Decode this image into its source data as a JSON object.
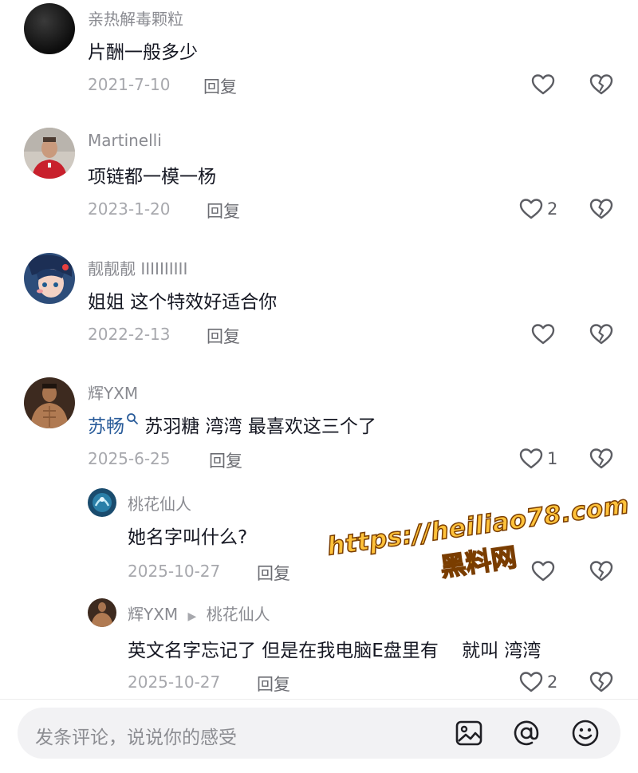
{
  "comments": [
    {
      "username": "亲热解毒颗粒",
      "text": "片酬一般多少",
      "date": "2021-7-10",
      "reply_label": "回复",
      "like_count": ""
    },
    {
      "username": "Martinelli",
      "text": "项链都一模一杨",
      "date": "2023-1-20",
      "reply_label": "回复",
      "like_count": "2"
    },
    {
      "username": "靓靓靓 IIIIIIIIII",
      "text": "姐姐 这个特效好适合你",
      "date": "2022-2-13",
      "reply_label": "回复",
      "like_count": ""
    },
    {
      "username": "辉YXM",
      "mention": "苏畅",
      "text": " 苏羽糖 湾湾 最喜欢这三个了",
      "date": "2025-6-25",
      "reply_label": "回复",
      "like_count": "1"
    }
  ],
  "replies": [
    {
      "username": "桃花仙人",
      "text": "她名字叫什么?",
      "date": "2025-10-27",
      "reply_label": "回复",
      "like_count": ""
    },
    {
      "username": "辉YXM",
      "reply_to": "桃花仙人",
      "text": "英文名字忘记了 但是在我电脑E盘里有    就叫 湾湾",
      "date": "2025-10-27",
      "reply_label": "回复",
      "like_count": "2"
    }
  ],
  "input": {
    "placeholder": "发条评论，说说你的感受",
    "icons": [
      "image-icon",
      "at-icon",
      "emoji-icon"
    ]
  },
  "watermark": {
    "url": "https://heiliao78.com",
    "name": "黑料网"
  },
  "colors": {
    "text": "#161823",
    "secondary": "#8a8b91",
    "mention": "#2a5c9a",
    "watermark": "#ffc23a"
  }
}
